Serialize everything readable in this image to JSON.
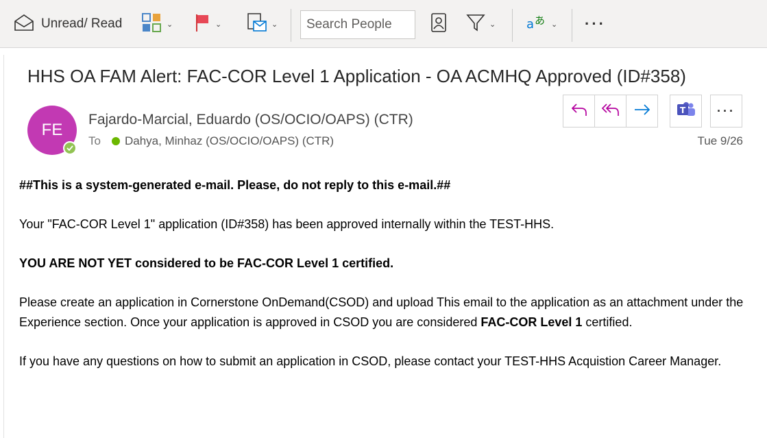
{
  "toolbar": {
    "unread_read_label": "Unread/ Read",
    "search_placeholder": "Search People",
    "more_label": "···"
  },
  "message": {
    "subject": "HHS OA FAM Alert: FAC-COR Level 1 Application - OA ACMHQ Approved (ID#358)",
    "sender_initials": "FE",
    "sender_name": "Fajardo-Marcial, Eduardo (OS/OCIO/OAPS) (CTR)",
    "to_label": "To",
    "recipient": "Dahya, Minhaz (OS/OCIO/OAPS) (CTR)",
    "date": "Tue 9/26",
    "more_actions_label": "···"
  },
  "body": {
    "line1": "##This is a system-generated e-mail. Please, do not reply to this e-mail.##",
    "line2": "Your \"FAC-COR Level 1\" application (ID#358) has been approved internally within the TEST-HHS.",
    "line3": "YOU ARE NOT YET considered to be FAC-COR Level 1 certified.",
    "line4a": "Please create an application in Cornerstone OnDemand(CSOD) and upload This email to the application as an attachment under the",
    "line4b_pre": "Experience section. Once your application is approved in CSOD you are considered ",
    "line4b_bold": "FAC-COR Level 1",
    "line4b_post": " certified.",
    "line5": "If you have any questions on how to submit an application in CSOD, please contact your TEST-HHS Acquistion Career Manager."
  },
  "colors": {
    "avatar": "#c239b3",
    "presence": "#92c353",
    "action_icon": "#b4009e",
    "teams": "#5b5fc7"
  }
}
